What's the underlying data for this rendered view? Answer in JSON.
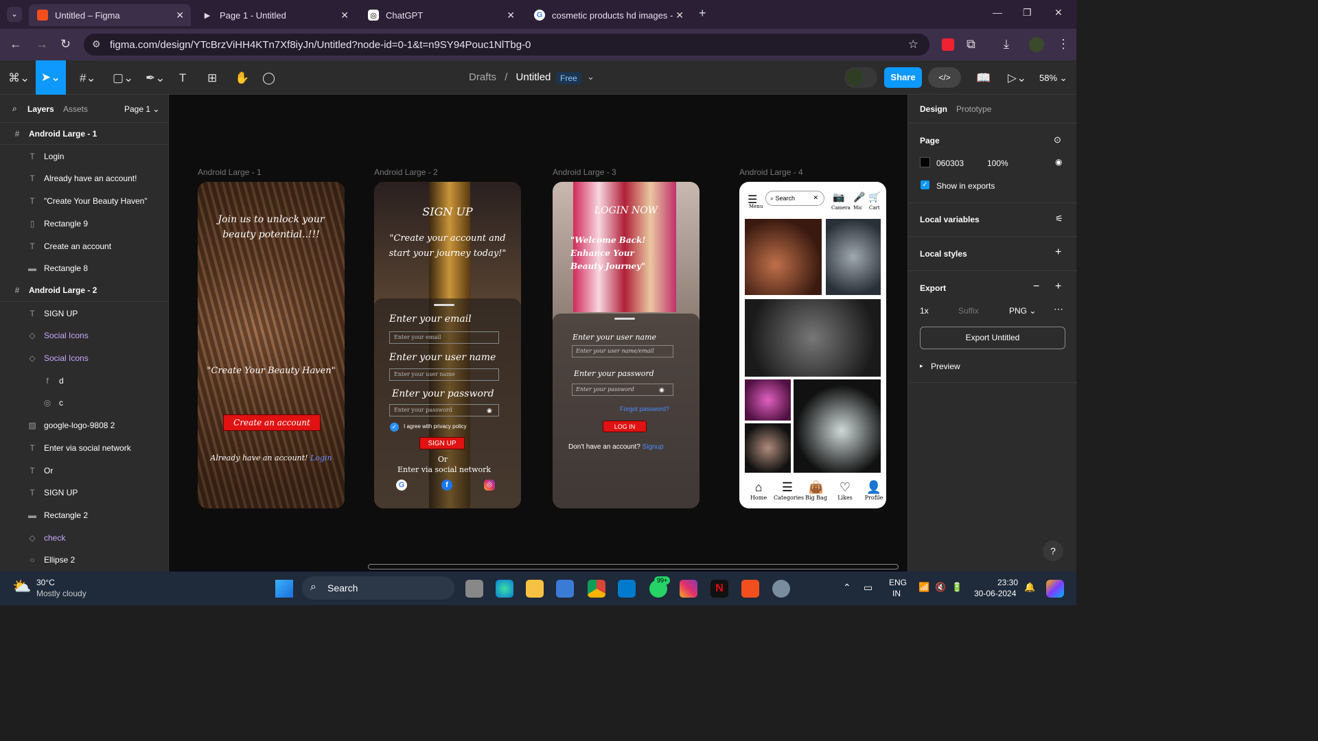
{
  "browser": {
    "tabs": [
      {
        "title": "Untitled – Figma",
        "active": true
      },
      {
        "title": "Page 1 - Untitled",
        "active": false
      },
      {
        "title": "ChatGPT",
        "active": false
      },
      {
        "title": "cosmetic products hd images -",
        "active": false
      }
    ],
    "url": "figma.com/design/YTcBrzViHH4KTn7Xf8iyJn/Untitled?node-id=0-1&t=n9SY94Pouc1NlTbg-0"
  },
  "figma": {
    "breadcrumb_team": "Drafts",
    "breadcrumb_sep": "/",
    "file_name": "Untitled",
    "plan_badge": "Free",
    "share_label": "Share",
    "zoom": "58%",
    "left_tabs": {
      "layers": "Layers",
      "assets": "Assets",
      "page": "Page 1"
    },
    "layers": [
      {
        "name": "Android Large - 1",
        "type": "frame",
        "indent": 0
      },
      {
        "name": "Login",
        "type": "text",
        "indent": 1
      },
      {
        "name": "Already have an account!",
        "type": "text",
        "indent": 1
      },
      {
        "name": "\"Create Your Beauty Haven\"",
        "type": "text",
        "indent": 1
      },
      {
        "name": "Rectangle 9",
        "type": "rect-v",
        "indent": 1
      },
      {
        "name": "Create an account",
        "type": "text",
        "indent": 1
      },
      {
        "name": "Rectangle 8",
        "type": "rect",
        "indent": 1
      },
      {
        "name": "Android Large - 2",
        "type": "frame",
        "indent": 0
      },
      {
        "name": "SIGN UP",
        "type": "text",
        "indent": 1
      },
      {
        "name": "Social Icons",
        "type": "component",
        "indent": 1
      },
      {
        "name": "Social Icons",
        "type": "component",
        "indent": 1
      },
      {
        "name": "d",
        "type": "facebook",
        "indent": 2
      },
      {
        "name": "c",
        "type": "instagram",
        "indent": 2
      },
      {
        "name": "google-logo-9808 2",
        "type": "image",
        "indent": 1
      },
      {
        "name": "Enter via social network",
        "type": "text",
        "indent": 1
      },
      {
        "name": "Or",
        "type": "text",
        "indent": 1
      },
      {
        "name": "SIGN UP",
        "type": "text",
        "indent": 1
      },
      {
        "name": "Rectangle 2",
        "type": "rect",
        "indent": 1
      },
      {
        "name": "check",
        "type": "component",
        "indent": 1
      },
      {
        "name": "Ellipse 2",
        "type": "ellipse",
        "indent": 1
      }
    ],
    "right": {
      "tabs": {
        "design": "Design",
        "prototype": "Prototype"
      },
      "page_label": "Page",
      "page_color": "060303",
      "page_opacity": "100%",
      "show_exports": "Show in exports",
      "local_variables": "Local variables",
      "local_styles": "Local styles",
      "export_label": "Export",
      "export_scale": "1x",
      "export_suffix": "Suffix",
      "export_format": "PNG",
      "export_button": "Export Untitled",
      "preview": "Preview"
    },
    "frames": [
      {
        "label": "Android Large - 1",
        "tagline": "Join us to unlock your beauty potential..!!!",
        "quote": "\"Create Your Beauty Haven\"",
        "cta": "Create an account",
        "have_account": "Already have an account!",
        "login_link": "Login"
      },
      {
        "label": "Android Large - 2",
        "title": "SIGN UP",
        "quote": "\"Create your account and start your journey today!\"",
        "email_label": "Enter your email",
        "email_ph": "Enter your email",
        "user_label": "Enter your user name",
        "user_ph": "Enter your user name",
        "pass_label": "Enter your password",
        "pass_ph": "Enter your password",
        "agree": "I agree with privacy policy",
        "signup_btn": "SIGN UP",
        "or": "Or",
        "social": "Enter via social network"
      },
      {
        "label": "Android Large - 3",
        "title": "LOGIN NOW",
        "quote": "\"Welcome Back! Enhance Your Beauty Journey\"",
        "user_label": "Enter your user name",
        "user_ph": "Enter your user name/email",
        "pass_label": "Enter your password",
        "pass_ph": "Enter your password",
        "forgot": "Forgot password?",
        "login_btn": "LOG IN",
        "no_account": "Don't have an account?",
        "signup_link": "Signup"
      },
      {
        "label": "Android Large - 4",
        "menu": "Menu",
        "search": "Search",
        "camera": "Camera",
        "mic": "Mic",
        "cart": "Cart",
        "nav": [
          "Home",
          "Categories",
          "Big Bag",
          "Likes",
          "Profile"
        ]
      }
    ]
  },
  "taskbar": {
    "weather_temp": "30°C",
    "weather_desc": "Mostly cloudy",
    "search": "Search",
    "lang": "ENG",
    "region": "IN",
    "time": "23:30",
    "date": "30-06-2024",
    "whatsapp_badge": "99+"
  }
}
